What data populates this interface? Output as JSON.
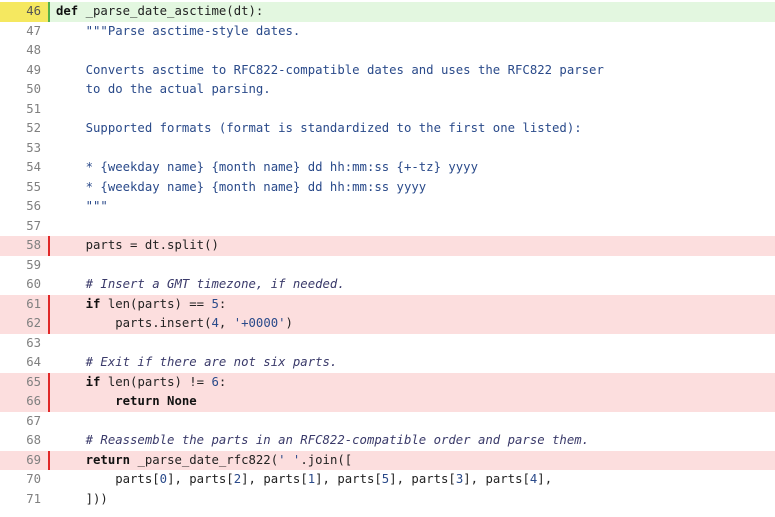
{
  "colors": {
    "covered_background": "#e3f7e0",
    "missed_background": "#fcdede",
    "missed_marker": "#e02828",
    "highlight_gutter": "#f5e860"
  },
  "code": {
    "lines": [
      {
        "n": "46",
        "status": "covered",
        "text": "def _parse_date_asctime(dt):"
      },
      {
        "n": "47",
        "status": "none",
        "text": "    \"\"\"Parse asctime-style dates."
      },
      {
        "n": "48",
        "status": "none",
        "text": ""
      },
      {
        "n": "49",
        "status": "none",
        "text": "    Converts asctime to RFC822-compatible dates and uses the RFC822 parser"
      },
      {
        "n": "50",
        "status": "none",
        "text": "    to do the actual parsing."
      },
      {
        "n": "51",
        "status": "none",
        "text": ""
      },
      {
        "n": "52",
        "status": "none",
        "text": "    Supported formats (format is standardized to the first one listed):"
      },
      {
        "n": "53",
        "status": "none",
        "text": ""
      },
      {
        "n": "54",
        "status": "none",
        "text": "    * {weekday name} {month name} dd hh:mm:ss {+-tz} yyyy"
      },
      {
        "n": "55",
        "status": "none",
        "text": "    * {weekday name} {month name} dd hh:mm:ss yyyy"
      },
      {
        "n": "56",
        "status": "none",
        "text": "    \"\"\""
      },
      {
        "n": "57",
        "status": "none",
        "text": ""
      },
      {
        "n": "58",
        "status": "missed",
        "text": "    parts = dt.split()"
      },
      {
        "n": "59",
        "status": "none",
        "text": ""
      },
      {
        "n": "60",
        "status": "none",
        "text": "    # Insert a GMT timezone, if needed."
      },
      {
        "n": "61",
        "status": "missed",
        "text": "    if len(parts) == 5:"
      },
      {
        "n": "62",
        "status": "missed",
        "text": "        parts.insert(4, '+0000')"
      },
      {
        "n": "63",
        "status": "none",
        "text": ""
      },
      {
        "n": "64",
        "status": "none",
        "text": "    # Exit if there are not six parts."
      },
      {
        "n": "65",
        "status": "missed",
        "text": "    if len(parts) != 6:"
      },
      {
        "n": "66",
        "status": "missed",
        "text": "        return None"
      },
      {
        "n": "67",
        "status": "none",
        "text": ""
      },
      {
        "n": "68",
        "status": "none",
        "text": "    # Reassemble the parts in an RFC822-compatible order and parse them."
      },
      {
        "n": "69",
        "status": "missed",
        "text": "    return _parse_date_rfc822(' '.join(["
      },
      {
        "n": "70",
        "status": "none",
        "text": "        parts[0], parts[2], parts[1], parts[5], parts[3], parts[4],"
      },
      {
        "n": "71",
        "status": "none",
        "text": "    ]))"
      }
    ]
  }
}
